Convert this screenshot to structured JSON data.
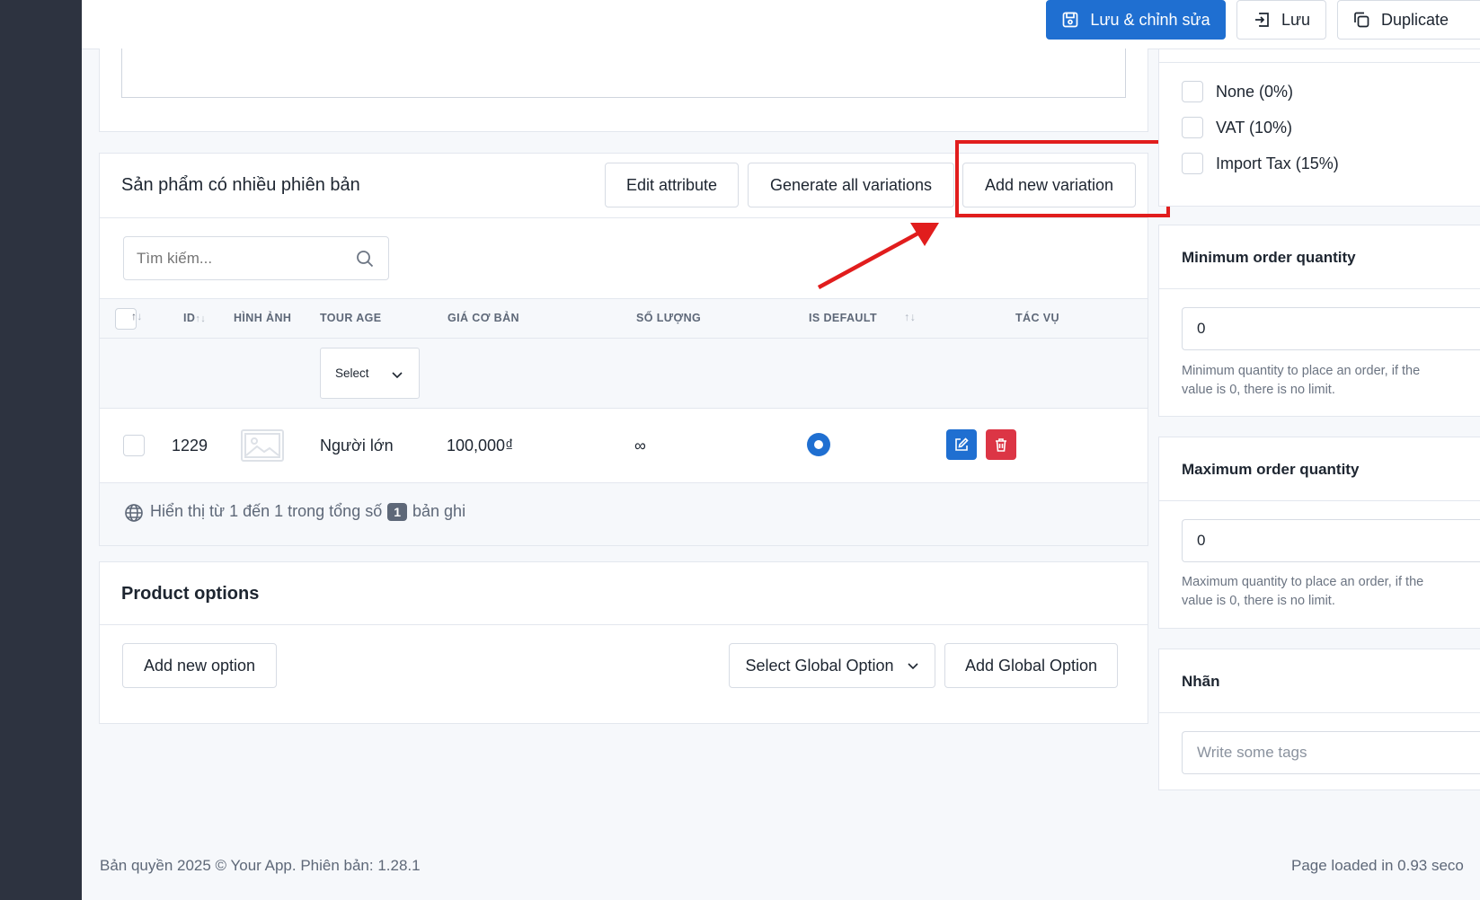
{
  "toolbar": {
    "save_edit_label": "Lưu & chỉnh sửa",
    "save_label": "Lưu",
    "duplicate_label": "Duplicate"
  },
  "variations": {
    "title": "Sản phẩm có nhiều phiên bản",
    "edit_attribute_label": "Edit attribute",
    "generate_all_label": "Generate all variations",
    "add_new_variation_label": "Add new variation",
    "search_placeholder": "Tìm kiếm...",
    "columns": {
      "id": "ID",
      "image": "HÌNH ẢNH",
      "tour_age": "TOUR AGE",
      "base_price": "GIÁ CƠ BẢN",
      "quantity": "SỐ LƯỢNG",
      "is_default": "IS DEFAULT",
      "actions": "TÁC VỤ"
    },
    "filter_select_label": "Select",
    "rows": [
      {
        "id": "1229",
        "tour_age": "Người lớn",
        "base_price": "100,000₫",
        "quantity": "∞",
        "is_default": true
      }
    ],
    "footer": {
      "prefix": "Hiển thị từ 1 đến 1 trong tổng số",
      "count": "1",
      "suffix": "bản ghi"
    }
  },
  "product_options": {
    "title": "Product options",
    "add_new_option_label": "Add new option",
    "select_global_option_label": "Select Global Option",
    "add_global_option_label": "Add Global Option"
  },
  "taxes": [
    {
      "label": "None (0%)"
    },
    {
      "label": "VAT (10%)"
    },
    {
      "label": "Import Tax (15%)"
    }
  ],
  "min_order": {
    "title": "Minimum order quantity",
    "value": "0",
    "help": "Minimum quantity to place an order, if the value is 0, there is no limit."
  },
  "max_order": {
    "title": "Maximum order quantity",
    "value": "0",
    "help": "Maximum quantity to place an order, if the value is 0, there is no limit."
  },
  "tags": {
    "title": "Nhãn",
    "placeholder": "Write some tags"
  },
  "page_footer": {
    "copyright": "Bản quyền 2025 © Your App. Phiên bản: 1.28.1",
    "load_time": "Page loaded in 0.93 seco"
  },
  "colors": {
    "primary": "#1f6fd1",
    "danger": "#dc3545",
    "annotation": "#e11d1d",
    "sidebar": "#2d3340"
  }
}
